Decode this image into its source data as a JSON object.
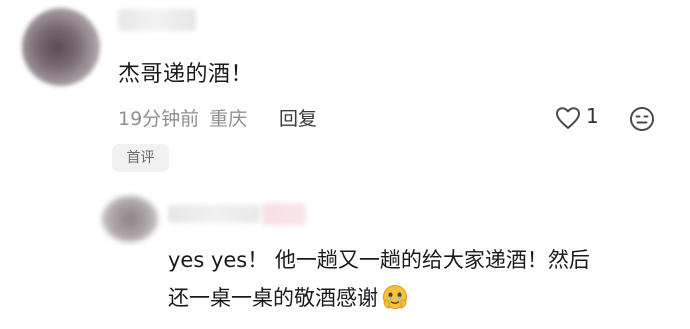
{
  "comment": {
    "text": "杰哥递的酒！",
    "time": "19分钟前",
    "location": "重庆",
    "reply_label": "回复",
    "like_count": "1",
    "badge": "首评"
  },
  "reply": {
    "line1": "yes yes！ 他一趟又一趟的给大家递酒！然后",
    "line2": "还一桌一桌的敬酒感谢"
  },
  "icons": {
    "like": "heart-outline-icon",
    "emoji": "smiley-icon",
    "reply_emoji": "grateful-face-emoji"
  }
}
